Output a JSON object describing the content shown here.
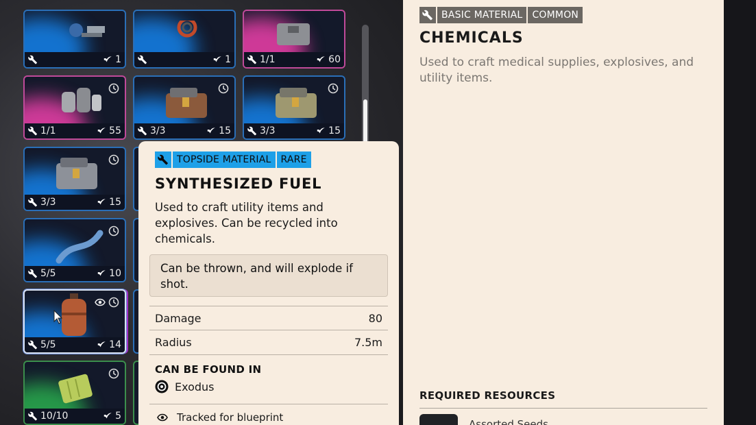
{
  "detail": {
    "tags": [
      "BASIC MATERIAL",
      "COMMON"
    ],
    "title": "CHEMICALS",
    "description": "Used to craft medical supplies, explosives, and utility items.",
    "required_heading": "REQUIRED RESOURCES",
    "required_item": "Assorted Seeds"
  },
  "tooltip": {
    "tags": [
      "TOPSIDE MATERIAL",
      "RARE"
    ],
    "title": "SYNTHESIZED FUEL",
    "description": "Used to craft utility items and explosives. Can be recycled into chemicals.",
    "note": "Can be thrown, and will explode if shot.",
    "stats": [
      {
        "label": "Damage",
        "value": "80"
      },
      {
        "label": "Radius",
        "value": "7.5m"
      }
    ],
    "found_heading": "CAN BE FOUND IN",
    "found_location": "Exodus",
    "tracked": "Tracked for blueprint"
  },
  "grid": {
    "cards": [
      {
        "craft": "",
        "count": "1"
      },
      {
        "craft": "",
        "count": "1"
      },
      {
        "craft": "1/1",
        "count": "60"
      },
      {
        "craft": "1/1",
        "count": "55"
      },
      {
        "craft": "3/3",
        "count": "15"
      },
      {
        "craft": "3/3",
        "count": "15"
      },
      {
        "craft": "3/3",
        "count": "15"
      },
      {
        "craft": "5/5",
        "count": "10"
      },
      {
        "craft": "5/5",
        "count": "14"
      },
      {
        "craft": "10/10",
        "count": "5"
      }
    ]
  }
}
